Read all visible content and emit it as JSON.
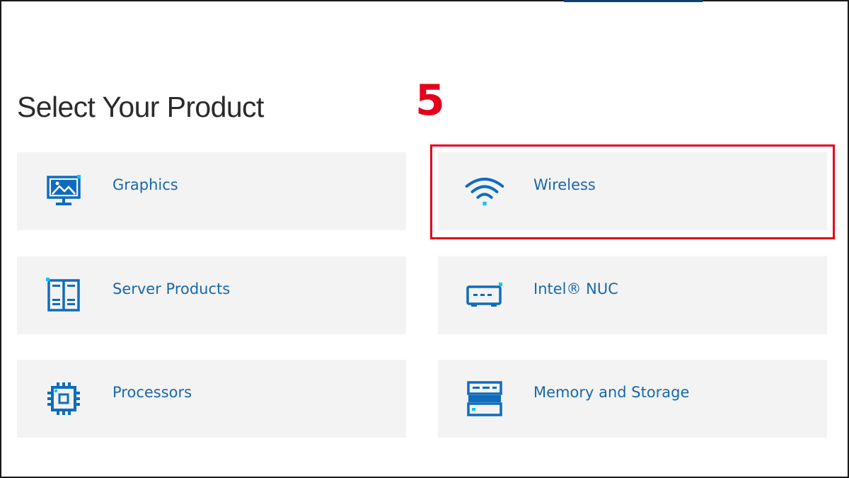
{
  "page": {
    "title": "Select Your Product"
  },
  "annotation": {
    "step_number": "5",
    "highlight_color": "#e4001b"
  },
  "colors": {
    "tile_background": "#f3f3f3",
    "label_color": "#1868a8",
    "icon_primary": "#0f6cbd",
    "icon_accent": "#00c7fd"
  },
  "products": [
    {
      "label": "Graphics",
      "icon": "monitor-picture-icon"
    },
    {
      "label": "Wireless",
      "icon": "wifi-icon",
      "highlighted": true
    },
    {
      "label": "Server Products",
      "icon": "server-rack-icon"
    },
    {
      "label": "Intel® NUC",
      "icon": "mini-pc-icon"
    },
    {
      "label": "Processors",
      "icon": "processor-chip-icon"
    },
    {
      "label": "Memory and Storage",
      "icon": "storage-drive-icon"
    }
  ]
}
